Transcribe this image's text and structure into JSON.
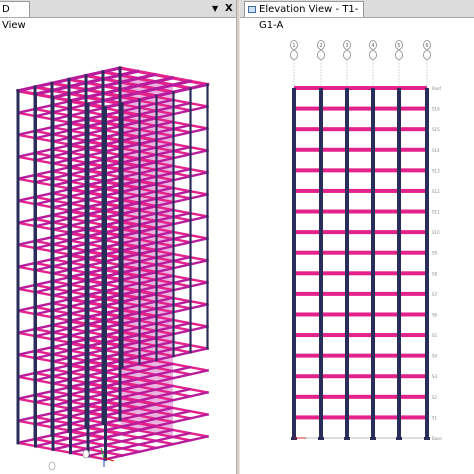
{
  "left_pane": {
    "tab_title": "D View",
    "menu_glyph": "▼",
    "close_glyph": "X"
  },
  "right_pane": {
    "tab_title": "Elevation View - T1-G1-A",
    "tab_icon": "window-icon"
  },
  "elevation": {
    "grid_bubbles": [
      "1",
      "2",
      "3",
      "4",
      "5",
      "6"
    ],
    "story_labels": [
      "Roof",
      "S16",
      "S15",
      "S14",
      "S13",
      "S12",
      "S11",
      "S10",
      "S9",
      "S8",
      "S7",
      "S6",
      "S5",
      "S4",
      "S3",
      "S2",
      "S1",
      "Base"
    ]
  },
  "colors": {
    "beam": "#e4228c",
    "column": "#2a2d5a",
    "slab": "#b81b9c"
  }
}
